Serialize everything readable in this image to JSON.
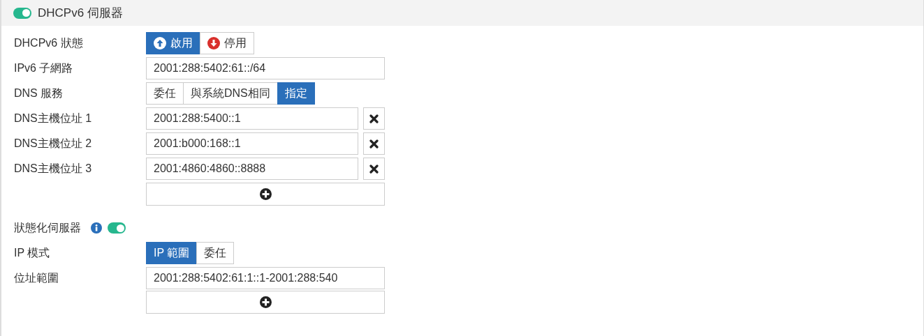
{
  "section": {
    "title": "DHCPv6 伺服器",
    "on": true
  },
  "status": {
    "label": "DHCPv6 狀態",
    "options": [
      {
        "label": "啟用",
        "kind": "up",
        "selected": true
      },
      {
        "label": "停用",
        "kind": "down",
        "selected": false
      }
    ]
  },
  "subnet": {
    "label": "IPv6 子網路",
    "value": "2001:288:5402:61::/64"
  },
  "dns_service": {
    "label": "DNS 服務",
    "options": [
      {
        "label": "委任",
        "selected": false
      },
      {
        "label": "與系統DNS相同",
        "selected": false
      },
      {
        "label": "指定",
        "selected": true
      }
    ]
  },
  "dns_servers": [
    {
      "label": "DNS主機位址 1",
      "value": "2001:288:5400::1"
    },
    {
      "label": "DNS主機位址 2",
      "value": "2001:b000:168::1"
    },
    {
      "label": "DNS主機位址 3",
      "value": "2001:4860:4860::8888"
    }
  ],
  "stateful": {
    "label": "狀態化伺服器",
    "on": true
  },
  "ip_mode": {
    "label": "IP 模式",
    "options": [
      {
        "label": "IP 範圍",
        "selected": true
      },
      {
        "label": "委任",
        "selected": false
      }
    ]
  },
  "address_range": {
    "label": "位址範圍",
    "values": [
      "2001:288:5402:61:1::1-2001:288:540"
    ]
  }
}
